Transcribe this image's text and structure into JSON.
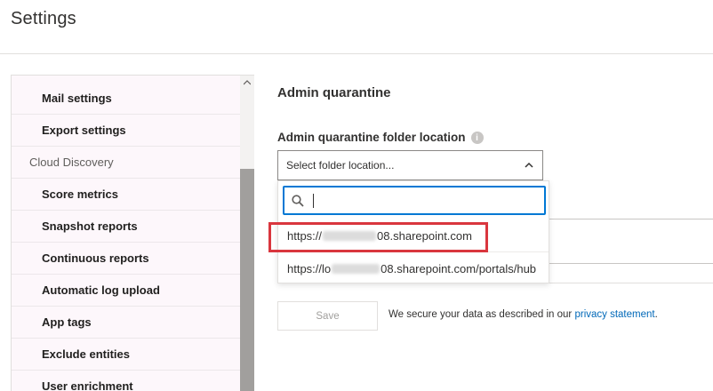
{
  "page": {
    "title": "Settings"
  },
  "sidebar": {
    "items": [
      {
        "label": "Mail settings",
        "type": "child"
      },
      {
        "label": "Export settings",
        "type": "child"
      },
      {
        "label": "Cloud Discovery",
        "type": "group"
      },
      {
        "label": "Score metrics",
        "type": "child"
      },
      {
        "label": "Snapshot reports",
        "type": "child"
      },
      {
        "label": "Continuous reports",
        "type": "child"
      },
      {
        "label": "Automatic log upload",
        "type": "child"
      },
      {
        "label": "App tags",
        "type": "child"
      },
      {
        "label": "Exclude entities",
        "type": "child"
      },
      {
        "label": "User enrichment",
        "type": "child"
      }
    ]
  },
  "main": {
    "section_title": "Admin quarantine",
    "folder_field": {
      "label": "Admin quarantine folder location",
      "info_icon": "info-icon",
      "placeholder": "Select folder location...",
      "search_value": "",
      "options": [
        {
          "prefix": "https://",
          "suffix": "08.sharepoint.com"
        },
        {
          "prefix": "https://lo",
          "suffix": "08.sharepoint.com/portals/hub"
        }
      ]
    },
    "save_label": "Save",
    "privacy_text": "We secure your data as described in our ",
    "privacy_link": "privacy statement",
    "privacy_end": "."
  },
  "colors": {
    "accent": "#0078d4",
    "highlight": "#d9363e",
    "link": "#0068b8"
  }
}
